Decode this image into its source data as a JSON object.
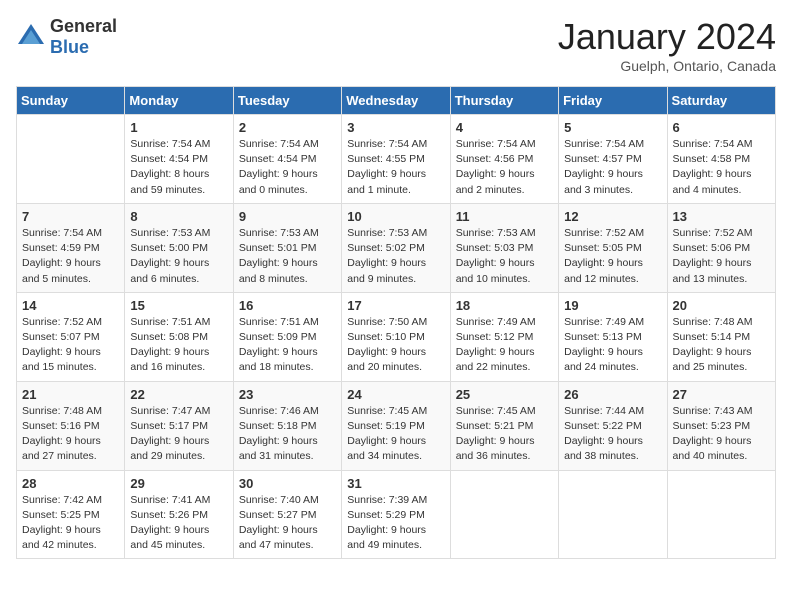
{
  "header": {
    "logo_general": "General",
    "logo_blue": "Blue",
    "month": "January 2024",
    "location": "Guelph, Ontario, Canada"
  },
  "days_of_week": [
    "Sunday",
    "Monday",
    "Tuesday",
    "Wednesday",
    "Thursday",
    "Friday",
    "Saturday"
  ],
  "weeks": [
    [
      {
        "day": "",
        "info": ""
      },
      {
        "day": "1",
        "info": "Sunrise: 7:54 AM\nSunset: 4:54 PM\nDaylight: 8 hours\nand 59 minutes."
      },
      {
        "day": "2",
        "info": "Sunrise: 7:54 AM\nSunset: 4:54 PM\nDaylight: 9 hours\nand 0 minutes."
      },
      {
        "day": "3",
        "info": "Sunrise: 7:54 AM\nSunset: 4:55 PM\nDaylight: 9 hours\nand 1 minute."
      },
      {
        "day": "4",
        "info": "Sunrise: 7:54 AM\nSunset: 4:56 PM\nDaylight: 9 hours\nand 2 minutes."
      },
      {
        "day": "5",
        "info": "Sunrise: 7:54 AM\nSunset: 4:57 PM\nDaylight: 9 hours\nand 3 minutes."
      },
      {
        "day": "6",
        "info": "Sunrise: 7:54 AM\nSunset: 4:58 PM\nDaylight: 9 hours\nand 4 minutes."
      }
    ],
    [
      {
        "day": "7",
        "info": "Sunrise: 7:54 AM\nSunset: 4:59 PM\nDaylight: 9 hours\nand 5 minutes."
      },
      {
        "day": "8",
        "info": "Sunrise: 7:53 AM\nSunset: 5:00 PM\nDaylight: 9 hours\nand 6 minutes."
      },
      {
        "day": "9",
        "info": "Sunrise: 7:53 AM\nSunset: 5:01 PM\nDaylight: 9 hours\nand 8 minutes."
      },
      {
        "day": "10",
        "info": "Sunrise: 7:53 AM\nSunset: 5:02 PM\nDaylight: 9 hours\nand 9 minutes."
      },
      {
        "day": "11",
        "info": "Sunrise: 7:53 AM\nSunset: 5:03 PM\nDaylight: 9 hours\nand 10 minutes."
      },
      {
        "day": "12",
        "info": "Sunrise: 7:52 AM\nSunset: 5:05 PM\nDaylight: 9 hours\nand 12 minutes."
      },
      {
        "day": "13",
        "info": "Sunrise: 7:52 AM\nSunset: 5:06 PM\nDaylight: 9 hours\nand 13 minutes."
      }
    ],
    [
      {
        "day": "14",
        "info": "Sunrise: 7:52 AM\nSunset: 5:07 PM\nDaylight: 9 hours\nand 15 minutes."
      },
      {
        "day": "15",
        "info": "Sunrise: 7:51 AM\nSunset: 5:08 PM\nDaylight: 9 hours\nand 16 minutes."
      },
      {
        "day": "16",
        "info": "Sunrise: 7:51 AM\nSunset: 5:09 PM\nDaylight: 9 hours\nand 18 minutes."
      },
      {
        "day": "17",
        "info": "Sunrise: 7:50 AM\nSunset: 5:10 PM\nDaylight: 9 hours\nand 20 minutes."
      },
      {
        "day": "18",
        "info": "Sunrise: 7:49 AM\nSunset: 5:12 PM\nDaylight: 9 hours\nand 22 minutes."
      },
      {
        "day": "19",
        "info": "Sunrise: 7:49 AM\nSunset: 5:13 PM\nDaylight: 9 hours\nand 24 minutes."
      },
      {
        "day": "20",
        "info": "Sunrise: 7:48 AM\nSunset: 5:14 PM\nDaylight: 9 hours\nand 25 minutes."
      }
    ],
    [
      {
        "day": "21",
        "info": "Sunrise: 7:48 AM\nSunset: 5:16 PM\nDaylight: 9 hours\nand 27 minutes."
      },
      {
        "day": "22",
        "info": "Sunrise: 7:47 AM\nSunset: 5:17 PM\nDaylight: 9 hours\nand 29 minutes."
      },
      {
        "day": "23",
        "info": "Sunrise: 7:46 AM\nSunset: 5:18 PM\nDaylight: 9 hours\nand 31 minutes."
      },
      {
        "day": "24",
        "info": "Sunrise: 7:45 AM\nSunset: 5:19 PM\nDaylight: 9 hours\nand 34 minutes."
      },
      {
        "day": "25",
        "info": "Sunrise: 7:45 AM\nSunset: 5:21 PM\nDaylight: 9 hours\nand 36 minutes."
      },
      {
        "day": "26",
        "info": "Sunrise: 7:44 AM\nSunset: 5:22 PM\nDaylight: 9 hours\nand 38 minutes."
      },
      {
        "day": "27",
        "info": "Sunrise: 7:43 AM\nSunset: 5:23 PM\nDaylight: 9 hours\nand 40 minutes."
      }
    ],
    [
      {
        "day": "28",
        "info": "Sunrise: 7:42 AM\nSunset: 5:25 PM\nDaylight: 9 hours\nand 42 minutes."
      },
      {
        "day": "29",
        "info": "Sunrise: 7:41 AM\nSunset: 5:26 PM\nDaylight: 9 hours\nand 45 minutes."
      },
      {
        "day": "30",
        "info": "Sunrise: 7:40 AM\nSunset: 5:27 PM\nDaylight: 9 hours\nand 47 minutes."
      },
      {
        "day": "31",
        "info": "Sunrise: 7:39 AM\nSunset: 5:29 PM\nDaylight: 9 hours\nand 49 minutes."
      },
      {
        "day": "",
        "info": ""
      },
      {
        "day": "",
        "info": ""
      },
      {
        "day": "",
        "info": ""
      }
    ]
  ]
}
